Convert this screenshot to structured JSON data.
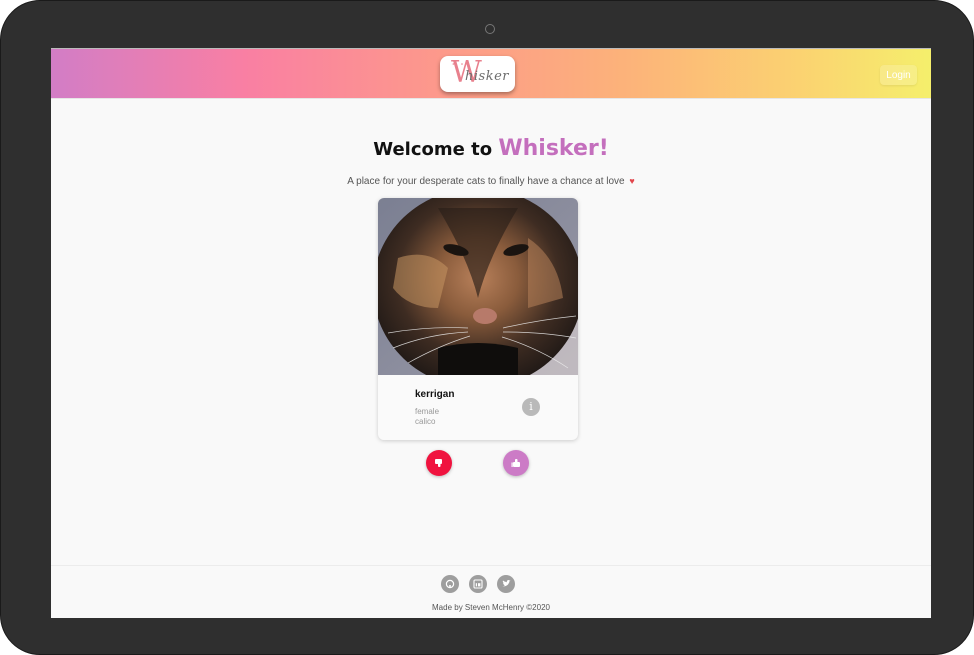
{
  "navbar": {
    "logo_text": "Whisker",
    "logo_initial": "W",
    "logo_rest": "hisker",
    "login_label": "Login"
  },
  "hero": {
    "welcome_prefix": "Welcome to",
    "brand": "Whisker!",
    "tagline": "A place for your desperate cats to finally have a chance at love"
  },
  "card": {
    "name": "kerrigan",
    "sex": "female",
    "breed": "calico",
    "info_icon": "info-icon"
  },
  "actions": {
    "dislike_icon": "thumbs-down-icon",
    "like_icon": "thumbs-up-icon",
    "dislike_color": "#f0133f",
    "like_color": "#cc7bc6"
  },
  "footer": {
    "icons": [
      "github-icon",
      "linkedin-icon",
      "twitter-icon"
    ],
    "credit": "Made by Steven McHenry ©2020"
  },
  "colors": {
    "brand": "#c46fbd",
    "heart": "#e2464c"
  }
}
